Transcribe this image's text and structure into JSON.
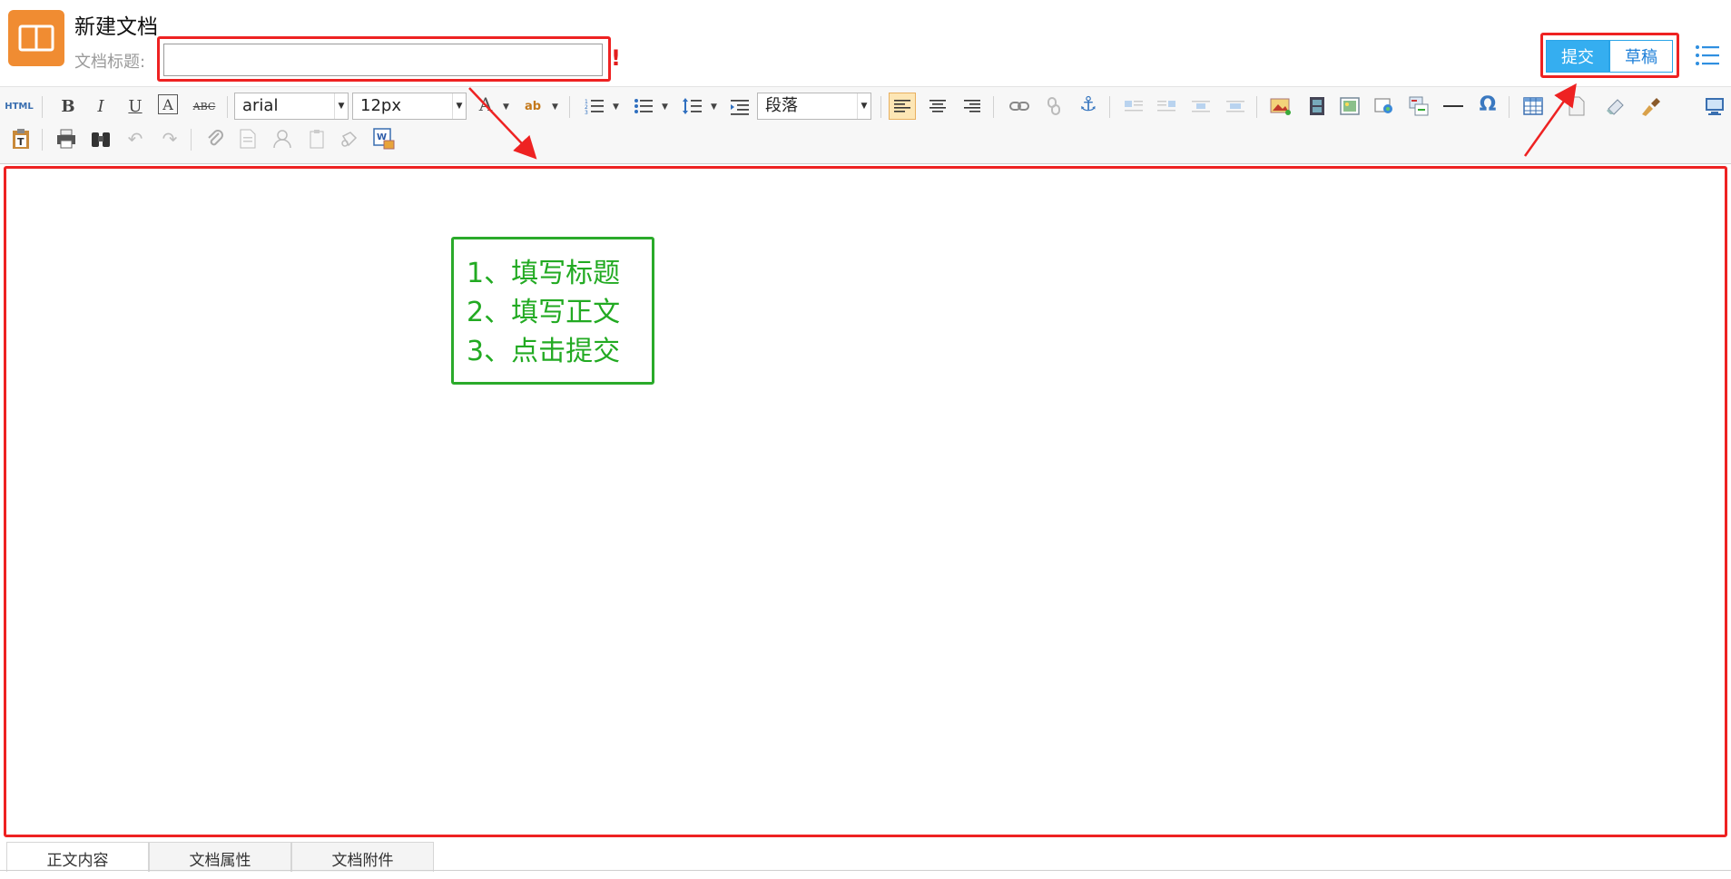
{
  "header": {
    "title": "新建文档",
    "title_label": "文档标题:",
    "title_value": "",
    "required_mark": "!",
    "submit_label": "提交",
    "draft_label": "草稿"
  },
  "toolbar": {
    "html_label": "HTML",
    "bold": "B",
    "italic": "I",
    "underline": "U",
    "font_color_letter": "A",
    "strike_label": "ABC",
    "font_family": "arial",
    "font_size": "12px",
    "highlight_label": "ab",
    "paragraph_format": "段落",
    "special_char": "Ω"
  },
  "editor": {
    "instructions": [
      "1、填写标题",
      "2、填写正文",
      "3、点击提交"
    ]
  },
  "tabs": [
    {
      "label": "正文内容",
      "active": true
    },
    {
      "label": "文档属性",
      "active": false
    },
    {
      "label": "文档附件",
      "active": false
    }
  ],
  "colors": {
    "accent": "#35aef0",
    "app_icon": "#f08c32",
    "annotation_red": "#ee2222",
    "annotation_green": "#22aa22"
  }
}
